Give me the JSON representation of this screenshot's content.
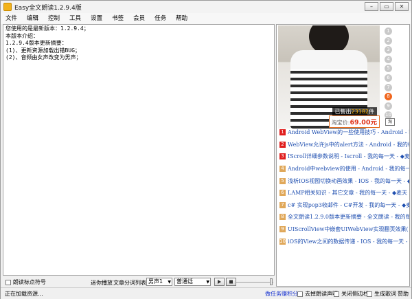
{
  "window": {
    "title": "Easy全文朗读1.2.9.4版",
    "buttons": [
      "–",
      "▭",
      "✕"
    ]
  },
  "menu": [
    "文件",
    "编辑",
    "控制",
    "工具",
    "设置",
    "书签",
    "会员",
    "任务",
    "帮助"
  ],
  "editor": {
    "lines": [
      "您使用的是最新版本：1.2.9.4；",
      "本版本介绍：",
      "1.2.9.4版本更新摘要：",
      "(1)、更新资源加载出错BUG；",
      "(2)、音频由女声改变为男声；"
    ]
  },
  "ad": {
    "sold_prefix": "已售出",
    "sold_count": "23182",
    "sold_suffix": "件",
    "price_label": "淘宝价:",
    "price_value": "69.00元",
    "pages": [
      "1",
      "2",
      "3",
      "4",
      "5",
      "6",
      "7",
      "8",
      "9",
      "10"
    ],
    "active_page": 8,
    "tag_icon": "淘"
  },
  "links": [
    {
      "num": "1",
      "hot": true,
      "text": "Android WebView的一些使用技巧 - Android - 我的"
    },
    {
      "num": "2",
      "hot": true,
      "text": "WebView允许js中的alert方法 - Android - 我的每一天"
    },
    {
      "num": "3",
      "hot": true,
      "text": "IScroll详细参数说明 - Iscroll - 我的每一天 - ◆麦天"
    },
    {
      "num": "4",
      "hot": false,
      "text": "Android中webview的使用 - Android - 我的每一天 -"
    },
    {
      "num": "5",
      "hot": false,
      "text": "浅析IOS视图切换动画效果 - IOS - 我的每一天 - ◆"
    },
    {
      "num": "6",
      "hot": false,
      "text": "LAMP相关知识 - 其它文章 - 我的每一天 - ◆麦天"
    },
    {
      "num": "7",
      "hot": false,
      "text": "c# 实现pop3收邮件 - C#开发 - 我的每一天 - ◆麦"
    },
    {
      "num": "8",
      "hot": false,
      "text": "全文朗读1.2.9.0版本更新摘要 - 全文朗读 - 我的每"
    },
    {
      "num": "9",
      "hot": false,
      "text": "UIScrollView中嵌套UIWebView实现翻页效果( - IOS"
    },
    {
      "num": "10",
      "hot": false,
      "text": "iOS的View之间的数据传递 - IOS - 我的每一天 - ◆"
    }
  ],
  "controls": {
    "read_punct": "朗读标点符号",
    "loop_play": "迷你播放",
    "split_list": "文章分词列表",
    "voice": "男声1",
    "mode": "普通话"
  },
  "status": {
    "loading": "正在加载资源...",
    "points": "做任务赚积分",
    "no_statement": "去掉朗读声明",
    "close_sidebar": "关闭侧边栏",
    "make_lyrics": "生成歌词",
    "help": "赞助"
  }
}
